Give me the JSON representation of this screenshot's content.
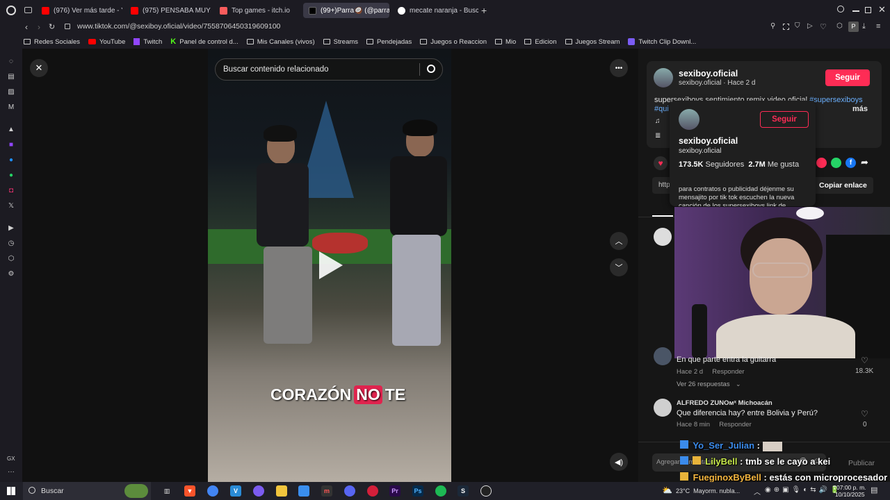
{
  "browser": {
    "tabs": [
      {
        "title": "(976) Ver más tarde - You",
        "fav_color": "#ff0000"
      },
      {
        "title": "(975) PENSABA MUY RA",
        "fav_color": "#ff0000"
      },
      {
        "title": "Top games - itch.io",
        "fav_color": "#fa5c5c"
      },
      {
        "title": "(99+)Parra🥥 (@parra0",
        "fav_color": "#000000"
      },
      {
        "title": "mecate naranja - Buscar c",
        "fav_color": "#4285f4"
      }
    ],
    "url": "www.tiktok.com/@sexiboy.oficial/video/7558706450319609100",
    "bookmarks": [
      {
        "label": "Redes Sociales",
        "type": "folder"
      },
      {
        "label": "YouTube",
        "type": "youtube"
      },
      {
        "label": "Twitch",
        "type": "twitch"
      },
      {
        "label": "Panel de control d...",
        "type": "kick"
      },
      {
        "label": "Mis Canales (vivos)",
        "type": "folder"
      },
      {
        "label": "Streams",
        "type": "folder"
      },
      {
        "label": "Pendejadas",
        "type": "folder"
      },
      {
        "label": "Juegos o Reaccion",
        "type": "folder"
      },
      {
        "label": "Mio",
        "type": "folder"
      },
      {
        "label": "Edicion",
        "type": "folder"
      },
      {
        "label": "Juegos Stream",
        "type": "folder"
      },
      {
        "label": "Twitch Clip Downl...",
        "type": "clip"
      }
    ],
    "sidebar_label": "GX"
  },
  "video": {
    "search_placeholder": "Buscar contenido relacionado",
    "caption_words": [
      "CORAZÓN",
      "NO",
      "TE"
    ]
  },
  "author": {
    "name": "sexiboy.oficial",
    "handle": "sexiboy.oficial",
    "time": "Hace 2 d",
    "follow_label": "Seguir",
    "description": "supersexiboys sentimiento remix video oficial",
    "hashtag": "#supersexiboys",
    "hashtag2": "#qui",
    "more_label": "más",
    "copy_link_label": "Copiar enlace",
    "link_prefix": "http"
  },
  "profile_card": {
    "name": "sexiboy.oficial",
    "handle": "sexiboy.oficial",
    "follow_label": "Seguir",
    "followers_count": "173.5K",
    "followers_label": "Seguidores",
    "likes_count": "2.7M",
    "likes_label": "Me gusta",
    "bio": "para contratos o publicidad déjenme su mensajito por tik tok escuchen la nueva canción de los supersexiboys link de"
  },
  "comments": [
    {
      "text": "En que parte entra la guitarra",
      "time": "Hace 2 d",
      "reply": "Responder",
      "likes": "18.3K",
      "replies": "Ver 26 respuestas"
    },
    {
      "user": "ALFREDO ZUNOᴍˣ Michoacán",
      "text": "Que diferencia hay? entre Bolivia y Perú?",
      "time": "Hace 8 min",
      "reply": "Responder",
      "likes": "0"
    }
  ],
  "comment_box": {
    "placeholder": "Agregar comentario...",
    "post_label": "Publicar"
  },
  "chat": [
    {
      "user": "Yo_Ser_Julian",
      "text": ":",
      "color": "#3b8beb"
    },
    {
      "user": "LilyBell",
      "text": ": tmb se le cayo a kei",
      "color": "#c7e84a"
    },
    {
      "user": "FueginoxByBell",
      "text": ": estás con microprocesador",
      "color": "#f5b63f"
    }
  ],
  "taskbar": {
    "search_label": "Buscar",
    "weather": "23°C  Mayorm. nubla...",
    "time": "07:00 p. m.",
    "date": "10/10/2025"
  }
}
